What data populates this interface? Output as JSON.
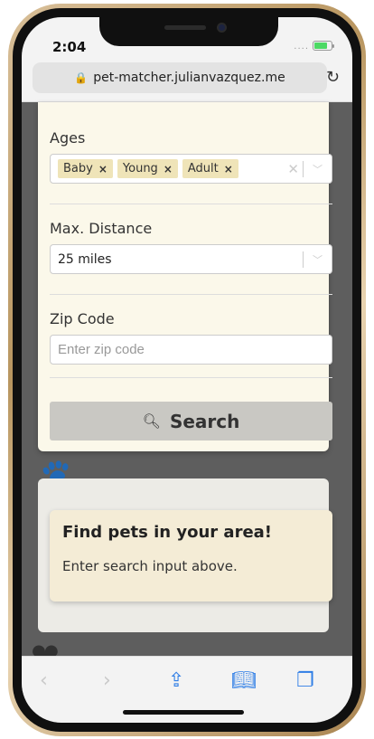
{
  "status": {
    "time": "2:04",
    "signal": "....",
    "battery_level": 0.8
  },
  "browser": {
    "url": "pet-matcher.julianvazquez.me",
    "icons": {
      "lock": "lock-icon",
      "reload": "reload-icon"
    }
  },
  "form": {
    "ages": {
      "label": "Ages",
      "chips": [
        "Baby",
        "Young",
        "Adult"
      ],
      "remove_glyph": "×"
    },
    "distance": {
      "label": "Max. Distance",
      "value": "25 miles"
    },
    "zip": {
      "label": "Zip Code",
      "placeholder": "Enter zip code"
    },
    "search_label": "Search"
  },
  "info": {
    "title": "Find pets in your area!",
    "text": "Enter search input above."
  },
  "toolbar": {
    "items": [
      "back-icon",
      "forward-icon",
      "share-icon",
      "bookmarks-icon",
      "tabs-icon"
    ]
  },
  "colors": {
    "card_bg": "#fbf8ea",
    "chip_bg": "#efe4b8",
    "button_bg": "#c9c8c3",
    "info_bg": "#f4ecd6",
    "ios_blue": "#2f7ee6"
  }
}
